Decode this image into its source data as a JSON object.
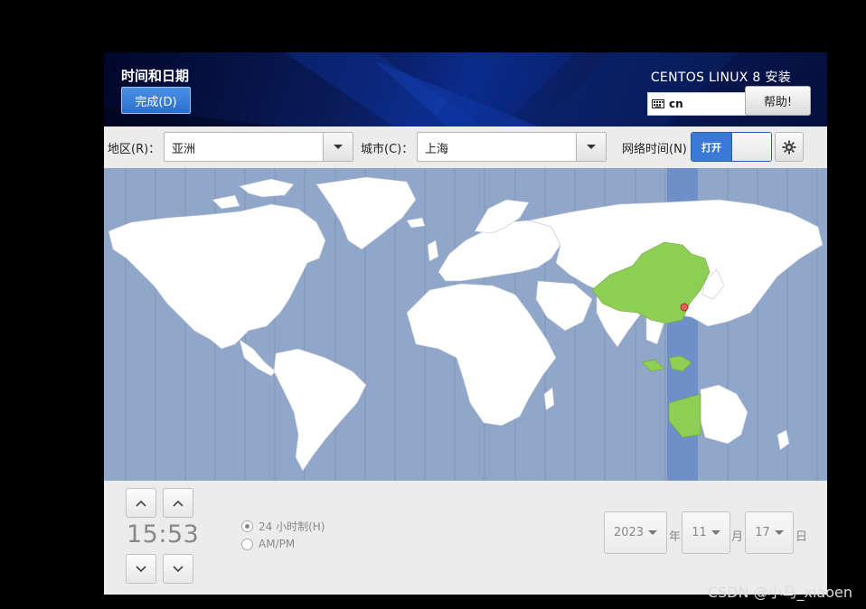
{
  "header": {
    "spoke_title": "时间和日期",
    "done_label": "完成(D)",
    "product_title": "CENTOS LINUX 8 安装",
    "keyboard_layout": "cn",
    "help_label": "帮助!"
  },
  "toolbar": {
    "region_label": "地区(R)：",
    "region_value": "亚洲",
    "city_label": "城市(C)：",
    "city_value": "上海",
    "ntp_label": "网络时间(N)",
    "ntp_toggle_label": "打开"
  },
  "time": {
    "value": "15:53",
    "format_24h_label": "24 小时制(H)",
    "format_ampm_label": "AM/PM",
    "selected_format": "24h"
  },
  "date": {
    "year": "2023",
    "year_unit": "年",
    "month": "11",
    "month_unit": "月",
    "day": "17",
    "day_unit": "日"
  },
  "watermark": "CSDN @小马_xiaoen",
  "colors": {
    "map_ocean": "#91a7c9",
    "map_land": "#ffffff",
    "map_selected_zone": "#8fce55",
    "map_selected_band": "#6f8fc9",
    "accent_blue": "#3a7ad6",
    "city_marker": "#e06060"
  },
  "icons": {
    "keyboard": "keyboard-icon",
    "settings": "gear-icon",
    "up": "chevron-up-icon",
    "down": "chevron-down-icon"
  }
}
